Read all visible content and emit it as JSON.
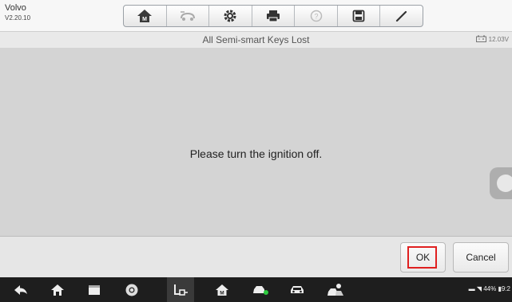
{
  "app": {
    "name": "Volvo",
    "version": "V2.20.10"
  },
  "toolbar": {
    "items": [
      {
        "name": "home",
        "icon": "home-m-icon"
      },
      {
        "name": "vehicle-swap",
        "icon": "vehicle-swap-icon"
      },
      {
        "name": "settings",
        "icon": "gear-icon"
      },
      {
        "name": "print",
        "icon": "printer-icon"
      },
      {
        "name": "help",
        "icon": "help-icon"
      },
      {
        "name": "save",
        "icon": "save-icon"
      },
      {
        "name": "edit",
        "icon": "pen-icon"
      }
    ]
  },
  "header": {
    "title": "All Semi-smart Keys Lost",
    "battery_voltage": "12.03V"
  },
  "main": {
    "message": "Please turn the ignition off."
  },
  "footer": {
    "ok_label": "OK",
    "cancel_label": "Cancel"
  },
  "navbar": {
    "icons": [
      "back-icon",
      "home-icon",
      "recent-apps-icon",
      "chrome-icon",
      "vci-icon",
      "home-m-icon",
      "car-connect-icon",
      "car-icon",
      "mechanic-icon"
    ],
    "status": {
      "battery": "44%",
      "time": "9:2"
    }
  },
  "colors": {
    "highlight": "#e02020",
    "content_bg": "#d4d4d4",
    "navbar_bg": "#1e1e1e"
  }
}
